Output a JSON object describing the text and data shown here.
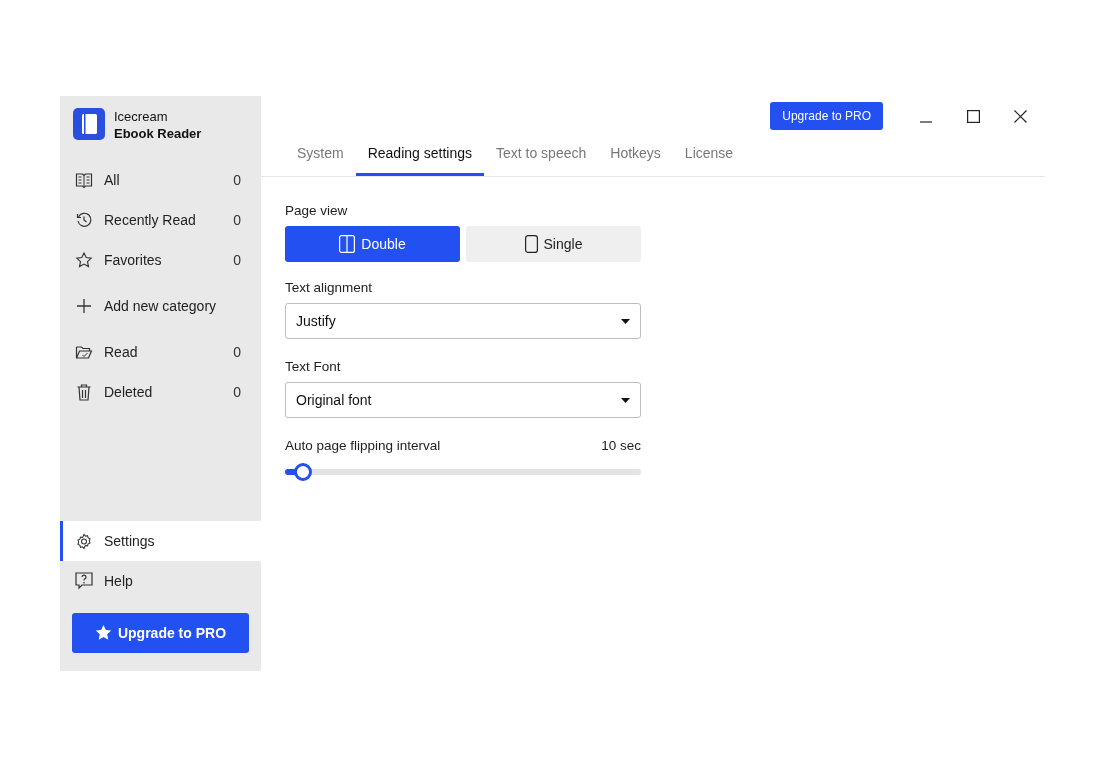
{
  "app": {
    "name_line1": "Icecream",
    "name_line2": "Ebook Reader"
  },
  "sidebar": {
    "items": [
      {
        "kind": "category",
        "label": "All",
        "count": "0",
        "selected": false
      },
      {
        "kind": "category",
        "label": "Recently Read",
        "count": "0",
        "selected": false
      },
      {
        "kind": "category",
        "label": "Favorites",
        "count": "0",
        "selected": false
      },
      {
        "kind": "add",
        "label": "Add new category",
        "selected": false
      },
      {
        "kind": "category",
        "label": "Read",
        "count": "0",
        "selected": false
      },
      {
        "kind": "category",
        "label": "Deleted",
        "count": "0",
        "selected": false
      }
    ],
    "bottom_items": [
      {
        "label": "Settings",
        "selected": true
      },
      {
        "label": "Help",
        "selected": false
      }
    ],
    "upgrade_button": "Upgrade to PRO"
  },
  "title_bar": {
    "upgrade_button": "Upgrade to PRO"
  },
  "tabs": [
    {
      "label": "System",
      "selected": false
    },
    {
      "label": "Reading settings",
      "selected": true
    },
    {
      "label": "Text to speech",
      "selected": false
    },
    {
      "label": "Hotkeys",
      "selected": false
    },
    {
      "label": "License",
      "selected": false
    }
  ],
  "settings": {
    "page_view": {
      "label": "Page view",
      "options": [
        {
          "label": "Double",
          "selected": true
        },
        {
          "label": "Single",
          "selected": false
        }
      ]
    },
    "text_alignment": {
      "label": "Text alignment",
      "value": "Justify"
    },
    "text_font": {
      "label": "Text Font",
      "value": "Original font"
    },
    "auto_flip": {
      "label": "Auto page flipping interval",
      "reading": "10 sec",
      "level": 0.05
    }
  }
}
